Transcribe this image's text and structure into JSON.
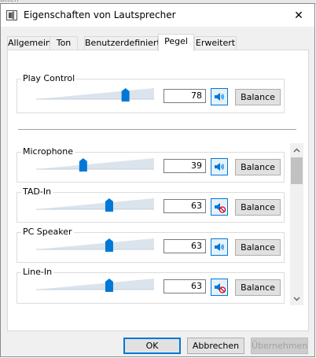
{
  "background_text": "atten",
  "window": {
    "title": "Eigenschaften von Lautsprecher",
    "close_glyph": "✕"
  },
  "tabs": [
    {
      "label": "Allgemein",
      "active": false
    },
    {
      "label": "Ton",
      "active": false
    },
    {
      "label": "Benutzerdefiniert",
      "active": false
    },
    {
      "label": "Pegel",
      "active": true
    },
    {
      "label": "Erweitert",
      "active": false
    }
  ],
  "master": {
    "label": "Play Control",
    "value": "78",
    "level": 78,
    "muted": false,
    "balance_label": "Balance"
  },
  "channels": [
    {
      "label": "Microphone",
      "value": "39",
      "level": 39,
      "muted": false,
      "balance_label": "Balance"
    },
    {
      "label": "TAD-In",
      "value": "63",
      "level": 63,
      "muted": true,
      "balance_label": "Balance"
    },
    {
      "label": "PC Speaker",
      "value": "63",
      "level": 63,
      "muted": false,
      "balance_label": "Balance"
    },
    {
      "label": "Line-In",
      "value": "63",
      "level": 63,
      "muted": true,
      "balance_label": "Balance"
    }
  ],
  "buttons": {
    "ok": "OK",
    "cancel": "Abbrechen",
    "apply": "Übernehmen"
  },
  "colors": {
    "accent": "#0078d7",
    "mute_red": "#d0021b"
  }
}
